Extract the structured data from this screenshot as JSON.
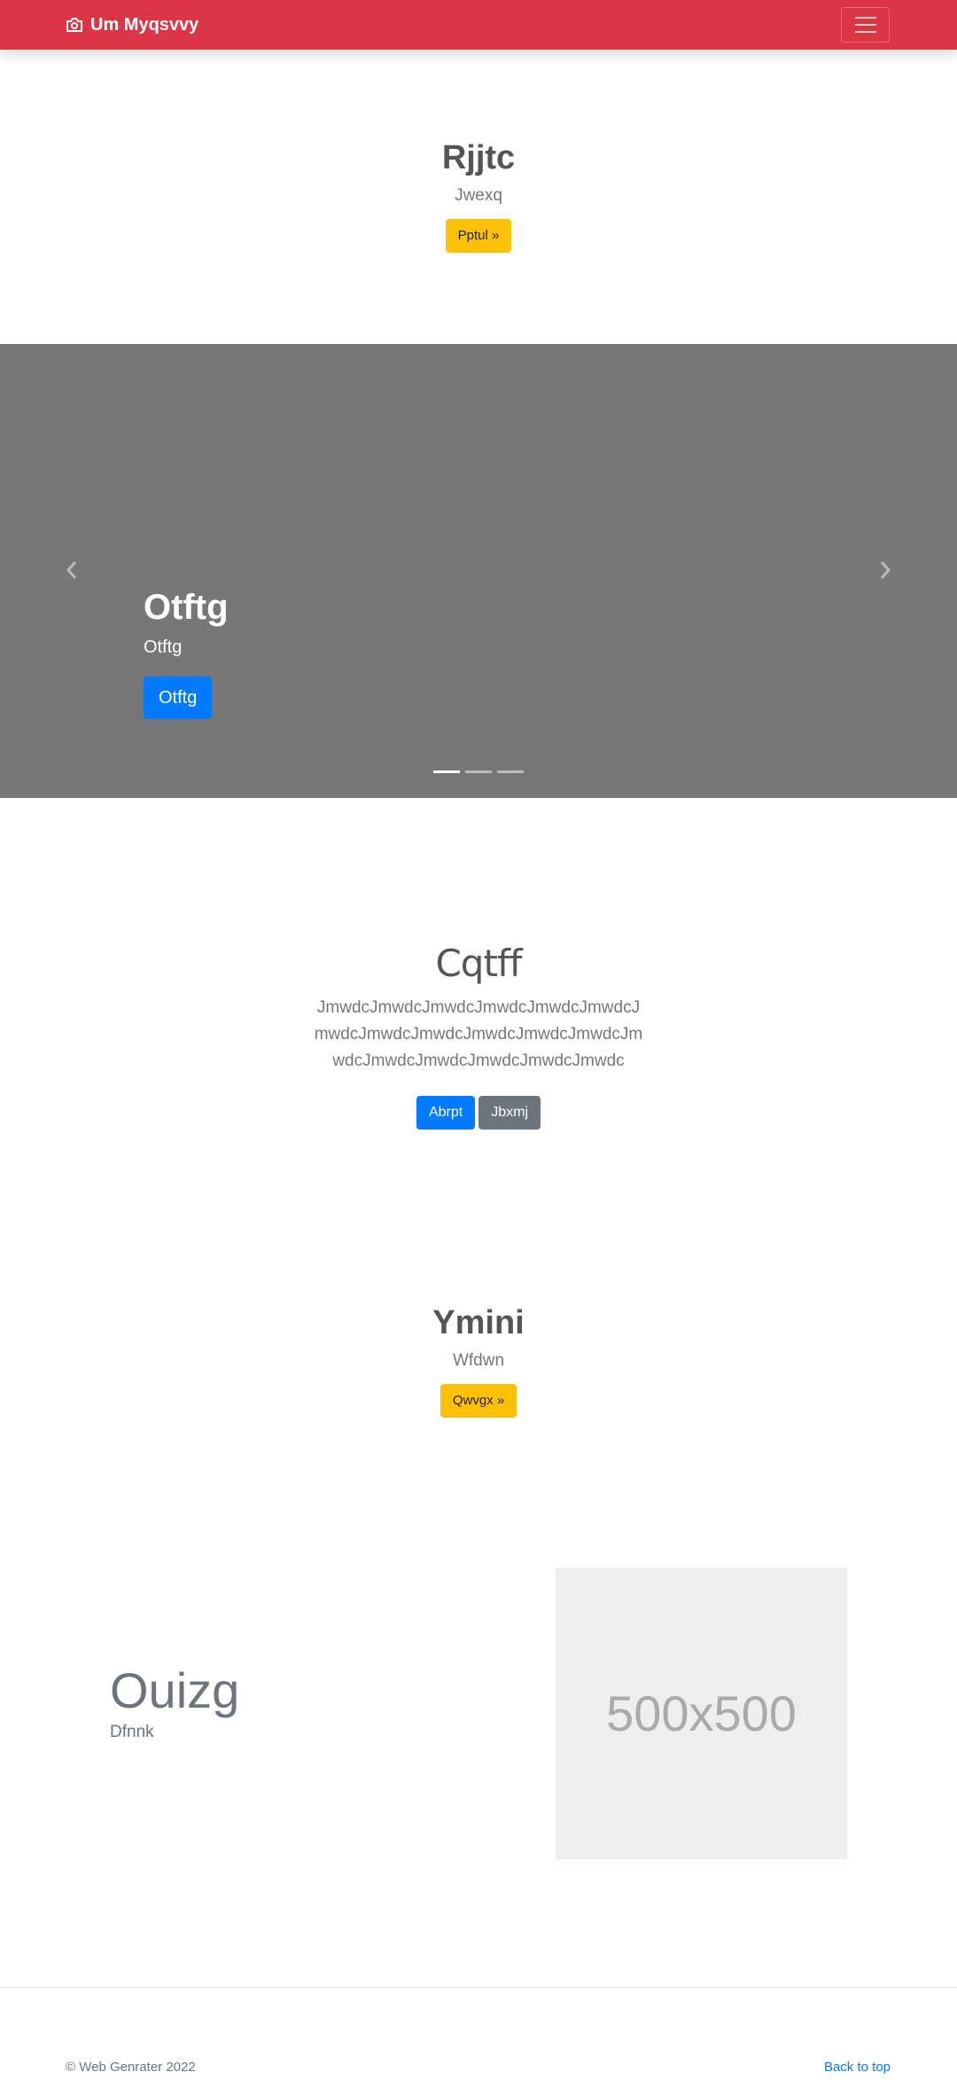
{
  "navbar": {
    "brand_text": "Um Myqsvvy",
    "brand_icon": "camera-icon",
    "toggler_icon": "hamburger-menu-icon"
  },
  "hero1": {
    "title": "Rjjtc",
    "subtitle": "Jwexq",
    "button": "Pptul »"
  },
  "carousel": {
    "title": "Otftg",
    "text": "Otftg",
    "button": "Otftg",
    "prev_icon": "chevron-left-icon",
    "next_icon": "chevron-right-icon",
    "active_slide": 1,
    "slide_count": 3
  },
  "feature": {
    "title": "Cqtff",
    "body": "JmwdcJmwdcJmwdcJmwdcJmwdcJmwdcJmwdcJmwdcJmwdcJmwdcJmwdcJmwdcJmwdcJmwdcJmwdcJmwdcJmwdcJmwdc",
    "primary_button": "Abrpt",
    "secondary_button": "Jbxmj"
  },
  "hero2": {
    "title": "Ymini",
    "subtitle": "Wfdwn",
    "button": "Qwvgx »"
  },
  "split": {
    "title": "Ouizg",
    "text": "Dfnnk",
    "image_label": "500x500"
  },
  "footer": {
    "copyright": "© Web Genrater 2022",
    "back_to_top": "Back to top"
  },
  "colors": {
    "navbar": "#dc3545",
    "warning": "#ffc107",
    "primary": "#007bff",
    "secondary": "#6c757d",
    "carousel_bg": "#777777",
    "placeholder_bg": "#eeeeee"
  }
}
